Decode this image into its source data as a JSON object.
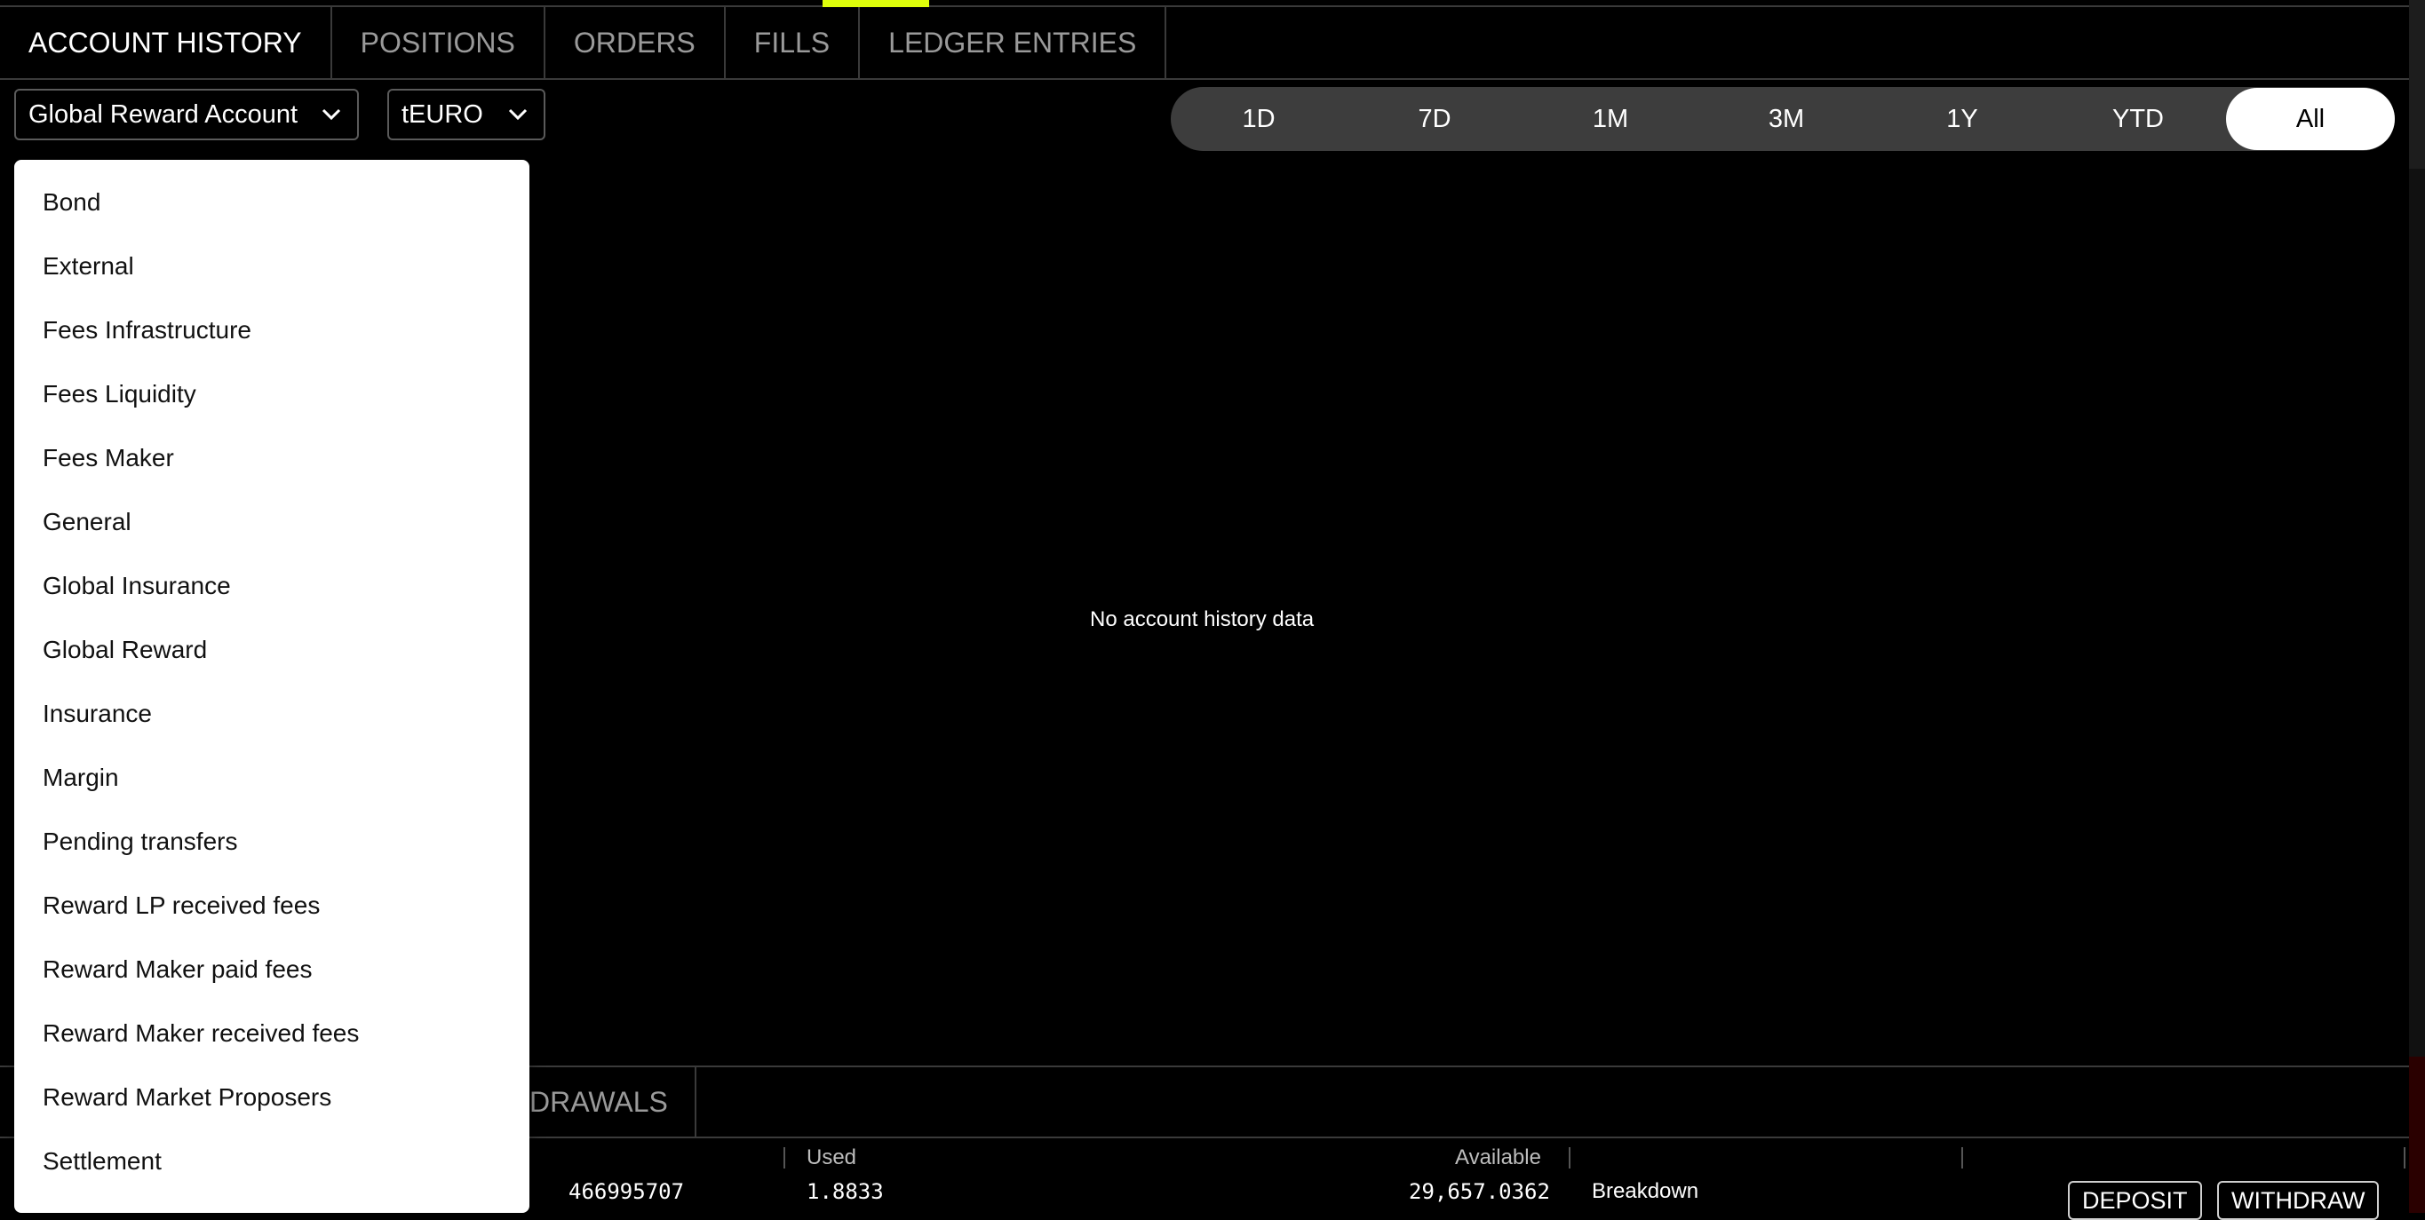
{
  "tabs": [
    "ACCOUNT HISTORY",
    "POSITIONS",
    "ORDERS",
    "FILLS",
    "LEDGER ENTRIES"
  ],
  "filters": {
    "account_type": "Global Reward Account",
    "asset": "tEURO"
  },
  "time_ranges": [
    "1D",
    "7D",
    "1M",
    "3M",
    "1Y",
    "YTD",
    "All"
  ],
  "selected_range": "All",
  "empty_message": "No account history data",
  "dropdown_items": [
    "Bond",
    "External",
    "Fees Infrastructure",
    "Fees Liquidity",
    "Fees Maker",
    "General",
    "Global Insurance",
    "Global Reward",
    "Insurance",
    "Margin",
    "Pending transfers",
    "Reward LP received fees",
    "Reward Maker paid fees",
    "Reward Maker received fees",
    "Reward Market Proposers",
    "Settlement"
  ],
  "bottom_tab_partial": "DRAWALS",
  "table": {
    "headers": {
      "used": "Used",
      "available": "Available"
    },
    "row": {
      "partial_id": "466995707",
      "used": "1.8833",
      "available": "29,657.0362",
      "breakdown": "Breakdown",
      "deposit": "DEPOSIT",
      "withdraw": "WITHDRAW"
    }
  },
  "icons": {
    "chevron": "chevron-down-icon"
  }
}
